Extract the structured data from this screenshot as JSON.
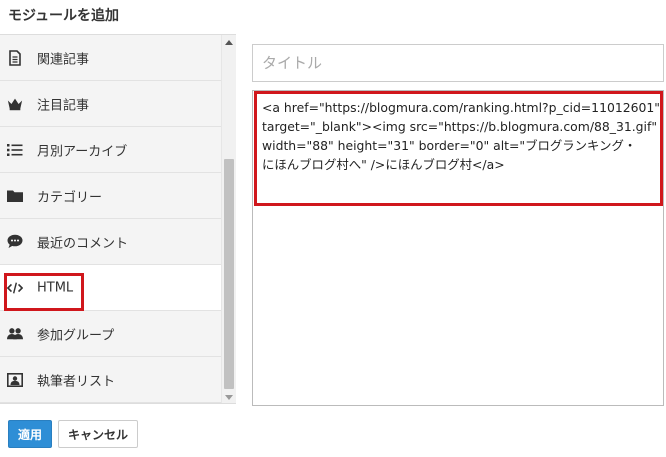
{
  "dialog": {
    "title": "モジュールを追加"
  },
  "sidebar": {
    "items": [
      {
        "label": "関連記事",
        "icon": "document-icon"
      },
      {
        "label": "注目記事",
        "icon": "crown-icon"
      },
      {
        "label": "月別アーカイブ",
        "icon": "list-icon"
      },
      {
        "label": "カテゴリー",
        "icon": "folder-icon"
      },
      {
        "label": "最近のコメント",
        "icon": "comment-icon"
      },
      {
        "label": "HTML",
        "icon": "code-icon",
        "selected": true
      },
      {
        "label": "参加グループ",
        "icon": "users-icon"
      },
      {
        "label": "執筆者リスト",
        "icon": "id-card-icon"
      }
    ]
  },
  "form": {
    "title_placeholder": "タイトル",
    "title_value": "",
    "html_lines": [
      "<a href=\"https://blogmura.com/ranking.html?p_cid=11012601\"",
      "target=\"_blank\"><img src=\"https://b.blogmura.com/88_31.gif\"",
      "width=\"88\" height=\"31\" border=\"0\" alt=\"ブログランキング・",
      "にほんブログ村へ\" />にほんブログ村</a>"
    ]
  },
  "footer": {
    "apply_label": "適用",
    "cancel_label": "キャンセル"
  },
  "colors": {
    "highlight": "#d0171c",
    "primary": "#2e8ed6"
  }
}
